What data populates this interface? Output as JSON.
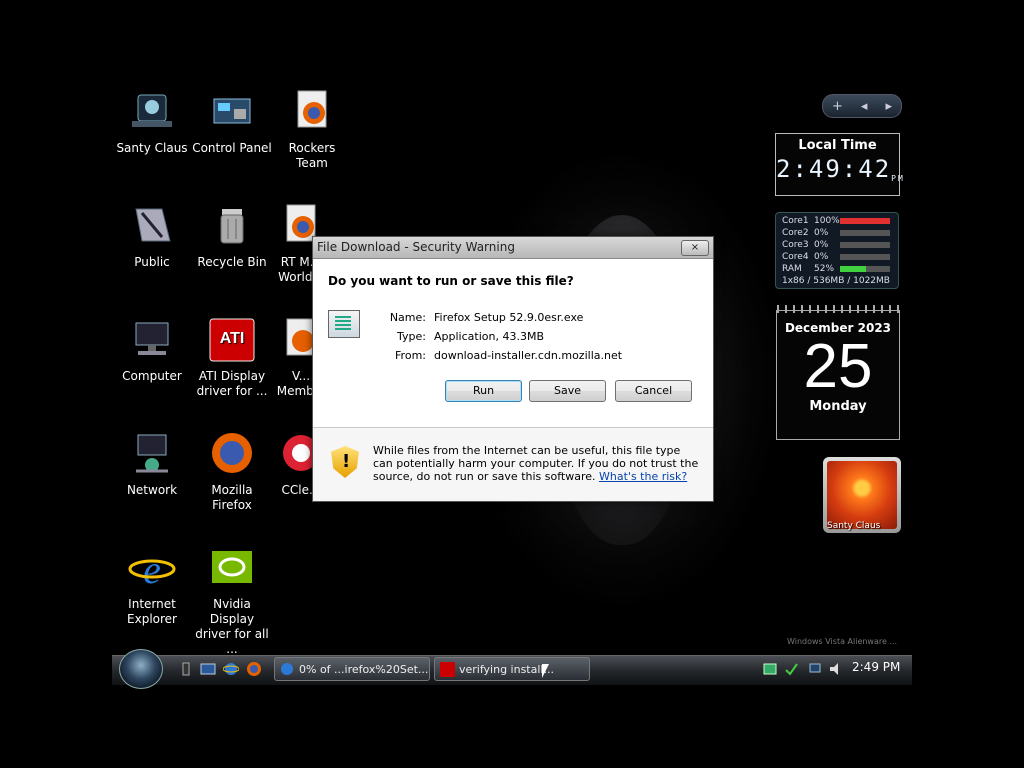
{
  "desktop_icons": [
    {
      "label": "Santy Claus"
    },
    {
      "label": "Control Panel"
    },
    {
      "label": "Rockers Team"
    },
    {
      "label": "Public"
    },
    {
      "label": "Recycle Bin"
    },
    {
      "label": "RT M... World..."
    },
    {
      "label": "Computer"
    },
    {
      "label": "ATI Display driver for ..."
    },
    {
      "label": "V... Memb..."
    },
    {
      "label": "Network"
    },
    {
      "label": "Mozilla Firefox"
    },
    {
      "label": "CCle..."
    },
    {
      "label": "Internet Explorer"
    },
    {
      "label": "Nvidia Display driver for all ..."
    }
  ],
  "gadgets": {
    "clock": {
      "title": "Local Time",
      "time": "2:49:42",
      "ampm": "PM"
    },
    "cpu": {
      "rows": [
        {
          "name": "Core1",
          "pct": "100%",
          "value": 1.0
        },
        {
          "name": "Core2",
          "pct": "0%",
          "value": 0
        },
        {
          "name": "Core3",
          "pct": "0%",
          "value": 0
        },
        {
          "name": "Core4",
          "pct": "0%",
          "value": 0
        },
        {
          "name": "RAM",
          "pct": "52%",
          "value": 0.52
        }
      ],
      "footer": "1x86 / 536MB / 1022MB"
    },
    "calendar": {
      "month": "December 2023",
      "day": "25",
      "weekday": "Monday"
    },
    "slideshow": {
      "caption": "Santy Claus"
    }
  },
  "watermark": "Windows Vista Alienware ...",
  "dialog": {
    "title": "File Download - Security Warning",
    "close": "×",
    "question": "Do you want to run or save this file?",
    "fields": [
      {
        "key": "Name:",
        "value": "Firefox Setup 52.9.0esr.exe"
      },
      {
        "key": "Type:",
        "value": "Application, 43.3MB"
      },
      {
        "key": "From:",
        "value": "download-installer.cdn.mozilla.net"
      }
    ],
    "buttons": {
      "run": "Run",
      "save": "Save",
      "cancel": "Cancel"
    },
    "warning": "While files from the Internet can be useful, this file type can potentially harm your computer. If you do not trust the source, do not run or save this software.",
    "warning_link": "What's the risk?"
  },
  "taskbar": {
    "tasks": [
      {
        "label": "0% of ...irefox%20Set..."
      },
      {
        "label": "verifying install..."
      }
    ],
    "clock": "2:49 PM"
  },
  "colors": {
    "accent": "#3c7fb1",
    "cpu_high": "#e03030",
    "ram": "#40d040"
  }
}
